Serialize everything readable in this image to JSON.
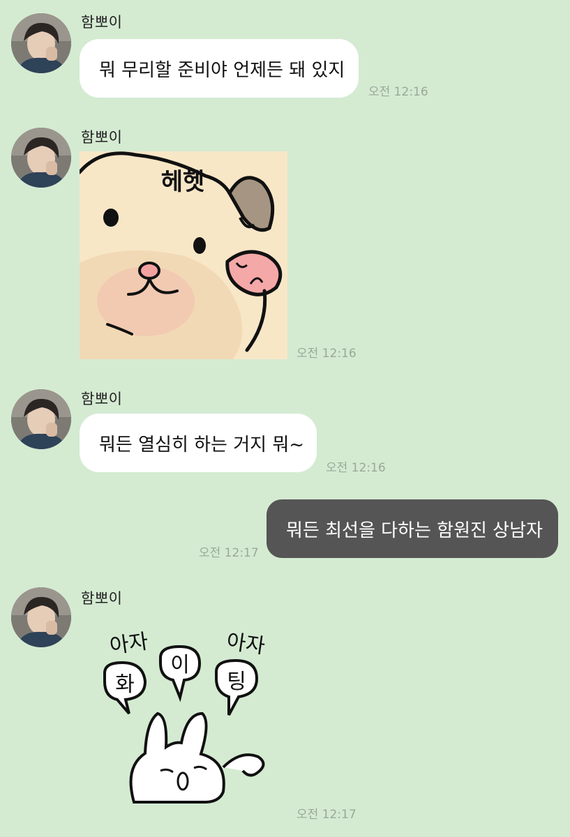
{
  "sender_name": "함뽀이",
  "messages": [
    {
      "sender": "함뽀이",
      "type": "text",
      "text": "뭐 무리할 준비야 언제든 돼 있지",
      "time": "오전 12:16"
    },
    {
      "sender": "함뽀이",
      "type": "sticker",
      "sticker": "hamster-hehet",
      "sticker_text": "헤헷",
      "time": "오전 12:16"
    },
    {
      "sender": "함뽀이",
      "type": "text",
      "text": "뭐든 열심히 하는 거지 뭐~",
      "time": "오전 12:16"
    },
    {
      "sender": "me",
      "type": "text",
      "text": "뭐든 최선을 다하는 함원진 상남자",
      "time": "오전 12:17"
    },
    {
      "sender": "함뽀이",
      "type": "sticker",
      "sticker": "rabbit-cheering",
      "sticker_text": [
        "아자",
        "화",
        "이",
        "팅",
        "아자"
      ],
      "time": "오전 12:17"
    }
  ],
  "colors": {
    "background": "#d4ebd2",
    "incoming_bubble": "#ffffff",
    "outgoing_bubble": "#555555",
    "timestamp": "#9aa898"
  },
  "icons": {
    "avatar": "profile-photo-avatar",
    "sticker_1": "hamster-sticker",
    "sticker_2": "rabbit-sticker"
  }
}
